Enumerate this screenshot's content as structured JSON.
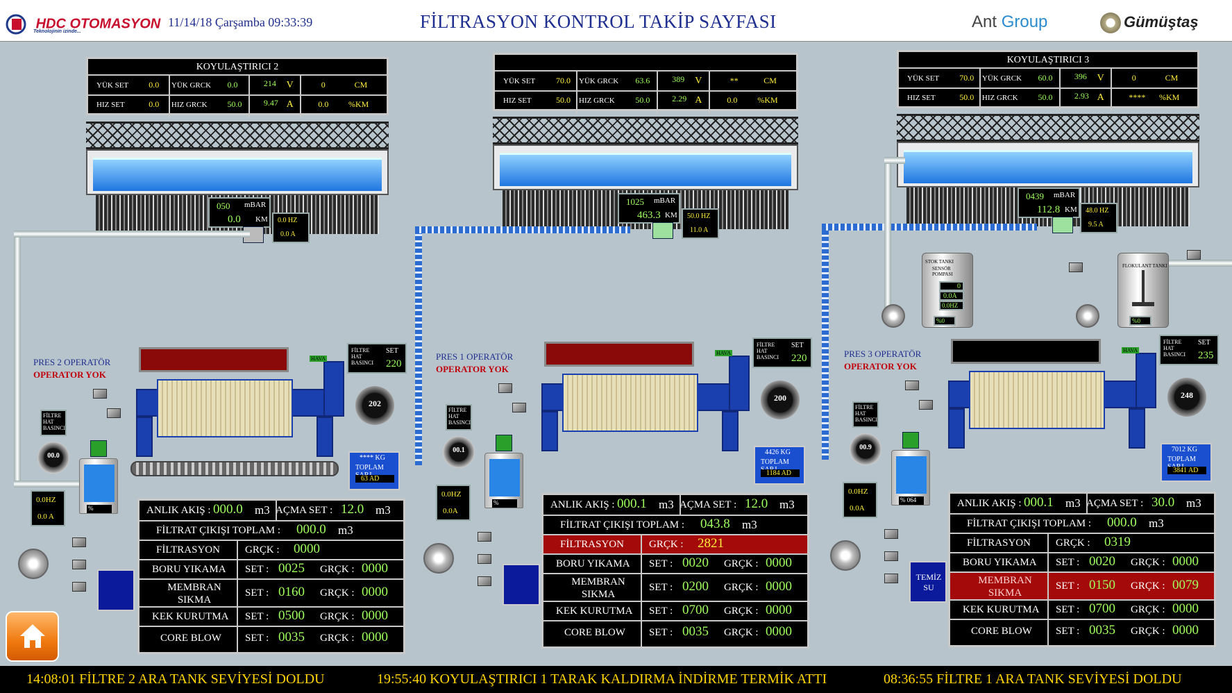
{
  "header": {
    "logo_text": "HDC OTOMASYON",
    "logo_sub": "Teknolojinin izinde...",
    "datetime": "11/14/18 Çarşamba 09:33:39",
    "title": "FİLTRASYON KONTROL TAKİP SAYFASI",
    "ant": "Ant",
    "ant_group": "Group",
    "gumustas": "Gümüştaş"
  },
  "thickeners": [
    {
      "title": "KOYULAŞTIRICI 2",
      "yuk_set_label": "YÜK   SET",
      "yuk_set": "0.0",
      "yuk_grck_label": "YÜK   GRCK",
      "yuk_grck": "0.0",
      "v_val": "214",
      "v_unit": "V",
      "cm_val": "0",
      "cm_unit": "CM",
      "hiz_set_label": "HIZ    SET",
      "hiz_set": "0.0",
      "hiz_grck_label": "HIZ    GRCK",
      "hiz_grck": "50.0",
      "a_val": "9.47",
      "a_unit": "A",
      "km_val": "0.0",
      "km_unit": "%KM",
      "mbar": "050",
      "mbar_unit": "mBAR",
      "km": "0.0",
      "km_u": "KM",
      "hz": "0.0 HZ",
      "amp": "0.0 A"
    },
    {
      "title": "",
      "yuk_set_label": "YÜK   SET",
      "yuk_set": "70.0",
      "yuk_grck_label": "YÜK   GRCK",
      "yuk_grck": "63.6",
      "v_val": "389",
      "v_unit": "V",
      "cm_val": "**",
      "cm_unit": "CM",
      "hiz_set_label": "HIZ    SET",
      "hiz_set": "50.0",
      "hiz_grck_label": "HIZ    GRCK",
      "hiz_grck": "50.0",
      "a_val": "2.29",
      "a_unit": "A",
      "km_val": "0.0",
      "km_unit": "%KM",
      "mbar": "1025",
      "mbar_unit": "mBAR",
      "km": "463.3",
      "km_u": "KM",
      "hz": "50.0 HZ",
      "amp": "11.0 A"
    },
    {
      "title": "KOYULAŞTIRICI 3",
      "yuk_set_label": "YÜK   SET",
      "yuk_set": "70.0",
      "yuk_grck_label": "YÜK   GRCK",
      "yuk_grck": "60.0",
      "v_val": "396",
      "v_unit": "V",
      "cm_val": "0",
      "cm_unit": "CM",
      "hiz_set_label": "HIZ    SET",
      "hiz_set": "50.0",
      "hiz_grck_label": "HIZ    GRCK",
      "hiz_grck": "50.0",
      "a_val": "2.93",
      "a_unit": "A",
      "km_val": "****",
      "km_unit": "%KM",
      "mbar": "0439",
      "mbar_unit": "mBAR",
      "km": "112.8",
      "km_u": "KM",
      "hz": "48.0 HZ",
      "amp": "9.5 A"
    }
  ],
  "presses": [
    {
      "operator": "PRES 2 OPERATÖR",
      "status": "OPERATOR YOK",
      "hava": "HAVA",
      "fhb_label": "FİLTRE HAT BASINCI",
      "set_label": "SET",
      "set_val": "220",
      "gauge": "202",
      "small_gauge": "00.0",
      "tank_pct": "%",
      "hz": "0.0HZ",
      "amp": "0.0 A",
      "kg": "**** KG",
      "toplam": "TOPLAM ŞARJ",
      "ad": "63 AD",
      "bluebox": ""
    },
    {
      "operator": "PRES 1 OPERATÖR",
      "status": "OPERATOR YOK",
      "hava": "HAVA",
      "fhb_label": "FİLTRE HAT BASINCI",
      "set_label": "SET",
      "set_val": "220",
      "gauge": "200",
      "small_gauge": "00.1",
      "tank_pct": "%",
      "hz": "0.0HZ",
      "amp": "0.0A",
      "kg": "4426 KG",
      "toplam": "TOPLAM ŞARJ",
      "ad": "1184 AD",
      "bluebox": ""
    },
    {
      "operator": "PRES 3 OPERATÖR",
      "status": "OPERATOR YOK",
      "hava": "HAVA",
      "fhb_label": "FİLTRE HAT BASINCI",
      "set_label": "SET",
      "set_val": "235",
      "gauge": "248",
      "small_gauge": "00.9",
      "tank_pct": "% 064",
      "hz": "0.0HZ",
      "amp": "0.0A",
      "kg": "7012 KG",
      "toplam": "TOPLAM ŞARJ",
      "ad": "3841 AD",
      "bluebox": "TEMİZ SU"
    }
  ],
  "tables": [
    {
      "anlik": "ANLIK AKIŞ :",
      "anlik_v": "000.0",
      "m3": "m3",
      "acma": "AÇMA SET :",
      "acma_v": "12.0",
      "filtrat": "FİLTRAT ÇIKIŞI TOPLAM :",
      "filtrat_v": "000.0",
      "filtrasyon": "FİLTRASYON",
      "grck": "GRÇK :",
      "filtrasyon_v": "0000",
      "boru": "BORU YIKAMA",
      "set": "SET :",
      "boru_set": "0025",
      "boru_grck": "0000",
      "membran": "MEMBRAN SIKMA",
      "membran_set": "0160",
      "membran_grck": "0000",
      "kek": "KEK KURUTMA",
      "kek_set": "0500",
      "kek_grck": "0000",
      "core": "CORE BLOW",
      "core_set": "0035",
      "core_grck": "0000"
    },
    {
      "anlik": "ANLIK AKIŞ :",
      "anlik_v": "000.1",
      "m3": "m3",
      "acma": "AÇMA SET :",
      "acma_v": "12.0",
      "filtrat": "FİLTRAT ÇIKIŞI TOPLAM :",
      "filtrat_v": "043.8",
      "filtrasyon": "FİLTRASYON",
      "grck": "GRÇK :",
      "filtrasyon_v": "2821",
      "boru": "BORU YIKAMA",
      "set": "SET :",
      "boru_set": "0020",
      "boru_grck": "0000",
      "membran": "MEMBRAN SIKMA",
      "membran_set": "0200",
      "membran_grck": "0000",
      "kek": "KEK KURUTMA",
      "kek_set": "0700",
      "kek_grck": "0000",
      "core": "CORE BLOW",
      "core_set": "0035",
      "core_grck": "0000"
    },
    {
      "anlik": "ANLIK AKIŞ :",
      "anlik_v": "000.1",
      "m3": "m3",
      "acma": "AÇMA SET :",
      "acma_v": "30.0",
      "filtrat": "FİLTRAT ÇIKIŞI TOPLAM :",
      "filtrat_v": "000.0",
      "filtrasyon": "FİLTRASYON",
      "grck": "GRÇK :",
      "filtrasyon_v": "0319",
      "boru": "BORU YIKAMA",
      "set": "SET :",
      "boru_set": "0020",
      "boru_grck": "0000",
      "membran": "MEMBRAN SIKMA",
      "membran_set": "0150",
      "membran_grck": "0079",
      "kek": "KEK KURUTMA",
      "kek_set": "0700",
      "kek_grck": "0000",
      "core": "CORE BLOW",
      "core_set": "0035",
      "core_grck": "0000"
    }
  ],
  "stok": {
    "label": "STOK TANKI",
    "label2": "SENSÖR POMPASI",
    "v1": "0",
    "v2": "0.0A",
    "v3": "0.0HZ",
    "pct": "%0",
    "flok": "FLOKULANT TANKI",
    "flok_pct": "%0"
  },
  "alarms": [
    "14:08:01 FİLTRE 2 ARA TANK SEVİYESİ DOLDU",
    "19:55:40 KOYULAŞTIRICI 1 TARAK KALDIRMA İNDİRME TERMİK ATTI",
    "08:36:55 FİLTRE 1 ARA TANK SEVİYESİ DOLDU"
  ],
  "colors": {
    "accent": "#1f2f8f",
    "alarm": "#ffd400",
    "lcd": "#9fff5c",
    "danger": "#a50a0a"
  }
}
